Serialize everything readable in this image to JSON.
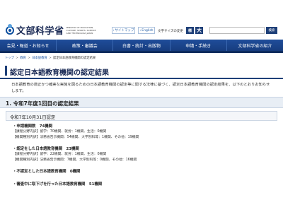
{
  "header": {
    "logo_text": "文部科学省",
    "logo_en": "MINISTRY OF EDUCATION, CULTURE, SPORTS, SCIENCE AND TECHNOLOGY-JAPAN",
    "sitemap_label": "サイトマップ",
    "english_label": "English",
    "font_size_label": "文字サイズの変更",
    "font_standard": "標",
    "font_large": "大",
    "search_placeholder": "",
    "search_button": "検索"
  },
  "nav": {
    "items": [
      {
        "label": "会見・報道・お知らせ"
      },
      {
        "label": "政策・審議会"
      },
      {
        "label": "白書・統計・出版物"
      },
      {
        "label": "申請・手続き"
      },
      {
        "label": "文部科学省の紹介"
      }
    ]
  },
  "breadcrumb": {
    "items": [
      "トップ",
      "教育",
      "日本語教育",
      "認定日本語教育機関の認定結果"
    ]
  },
  "page_title": "認定日本語教育機関の認定結果",
  "intro": "日本語教育の適正かつ確実な実施を図るための日本語教育機関の認定等に関する法律に基づく、認定日本語教育機関の認定結果を、以下のとおりお知らせします。",
  "section1": {
    "heading": "1. 令和7年度1回目の認定結果",
    "subheading": "令和7年10月31日認定",
    "blocks": [
      {
        "title": "・申請機関数　74機関",
        "lines": [
          "【課程分野内訳】留学：70機関、就労：1機関、生活：0機関",
          "【機関種別内訳】法務省告示機関：54機関、大学別科等：1機関、その他：19機関"
        ]
      },
      {
        "title": "・認定をした日本語教育機関　23機関",
        "lines": [
          "【課程分野内訳】留学：22機関、就労：1機関、生活：0機関",
          "【機関種別内訳】法務省告示機関：7機関、大学別科等：0機関、その他：16機関"
        ]
      },
      {
        "title": "・不認定とした日本語教育機関　0機関",
        "lines": []
      },
      {
        "title": "・審査中に取下げを行った日本語教育機関　51機関",
        "lines": []
      }
    ]
  },
  "colors": {
    "nav_bg": "#1f4d9a",
    "title_accent": "#1e3f78",
    "link": "#1a55a5"
  }
}
